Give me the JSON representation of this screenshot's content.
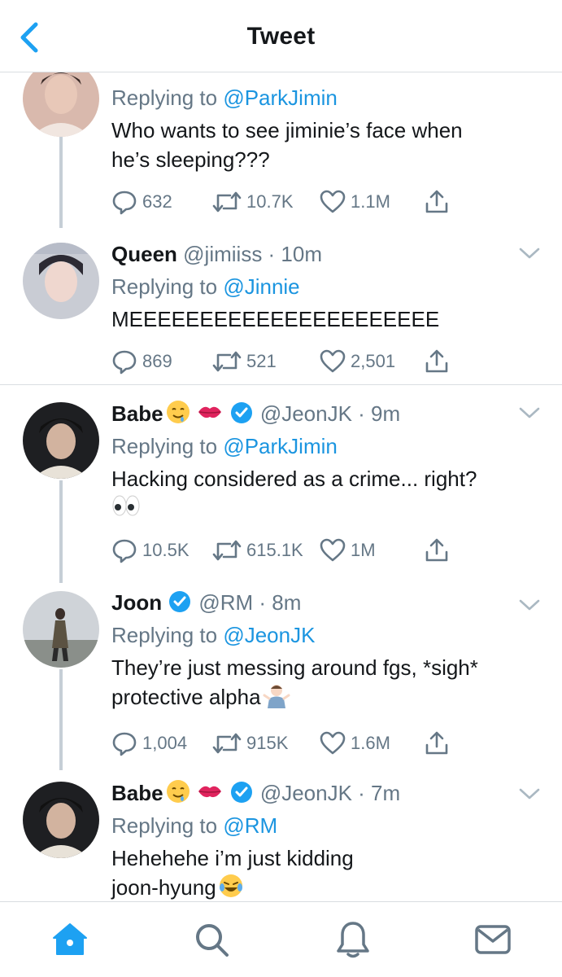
{
  "header": {
    "title": "Tweet"
  },
  "tweets": [
    {
      "name": "",
      "handle": "",
      "reply_prefix": "Replying to",
      "reply_to": "@ParkJimin",
      "body_lines": [
        "Who wants to see jiminie’s face when",
        "he’s sleeping???"
      ],
      "replies": "632",
      "retweets": "10.7K",
      "likes": "1.1M"
    },
    {
      "name": "Queen",
      "handle": "@jimiiss · 10m",
      "reply_prefix": "Replying to",
      "reply_to": "@Jinnie",
      "body_lines": [
        "MEEEEEEEEEEEEEEEEEEEEEE"
      ],
      "replies": "869",
      "retweets": "521",
      "likes": "2,501"
    },
    {
      "name": "Babe",
      "handle": "@JeonJK · 9m",
      "reply_prefix": "Replying to",
      "reply_to": "@ParkJimin",
      "body_lines": [
        "Hacking considered as a crime... right?"
      ],
      "replies": "10.5K",
      "retweets": "615.1K",
      "likes": "1M"
    },
    {
      "name": "Joon",
      "handle": "@RM · 8m",
      "reply_prefix": "Replying to",
      "reply_to": "@JeonJK",
      "body_lines": [
        "They’re just messing around fgs, *sigh*",
        "protective alpha"
      ],
      "replies": "1,004",
      "retweets": "915K",
      "likes": "1.6M"
    },
    {
      "name": "Babe",
      "handle": "@JeonJK · 7m",
      "reply_prefix": "Replying to",
      "reply_to": "@RM",
      "body_lines": [
        "Hehehehe i’m just kidding",
        "joon-hyung"
      ]
    }
  ],
  "colors": {
    "accent": "#1da1f2",
    "mention": "#1b95e0",
    "muted": "#657786",
    "divider": "#d9dde1"
  },
  "icons": [
    "back-chevron-icon",
    "reply-icon",
    "retweet-icon",
    "like-icon",
    "share-icon",
    "caret-down-icon",
    "verified-icon",
    "home-icon",
    "search-icon",
    "notifications-icon",
    "messages-icon"
  ]
}
